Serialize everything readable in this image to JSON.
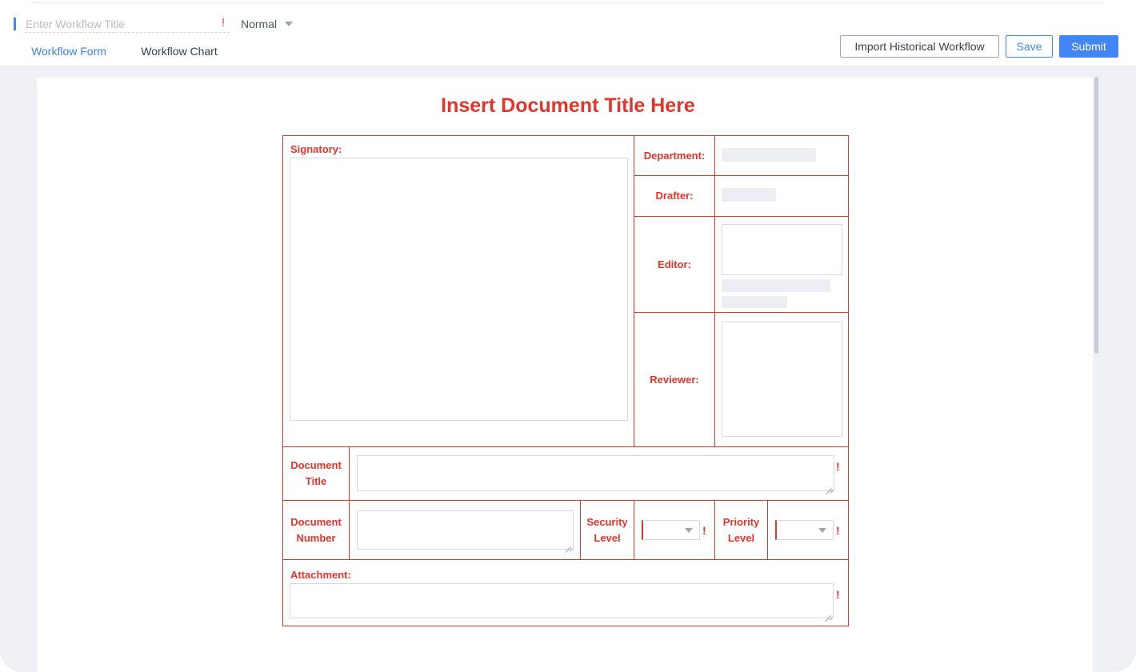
{
  "header": {
    "title_placeholder": "Enter Workflow Title",
    "required_mark": "!",
    "priority_value": "Normal"
  },
  "tabs": [
    {
      "label": "Workflow Form",
      "active": true
    },
    {
      "label": "Workflow Chart",
      "active": false
    }
  ],
  "buttons": {
    "import_label": "Import Historical Workflow",
    "save_label": "Save",
    "submit_label": "Submit"
  },
  "document": {
    "title": "Insert Document Title Here",
    "labels": {
      "signatory": "Signatory:",
      "department": "Department:",
      "drafter": "Drafter:",
      "editor": "Editor:",
      "reviewer": "Reviewer:",
      "doc_title_l1": "Document",
      "doc_title_l2": "Title",
      "doc_number_l1": "Document",
      "doc_number_l2": "Number",
      "security_l1": "Security",
      "security_l2": "Level",
      "priority_l1": "Priority",
      "priority_l2": "Level",
      "attachment": "Attachment:"
    },
    "required_mark": "!"
  },
  "colors": {
    "accent": "#4285f4",
    "form_red": "#e5352b",
    "background": "#eef0f4"
  }
}
